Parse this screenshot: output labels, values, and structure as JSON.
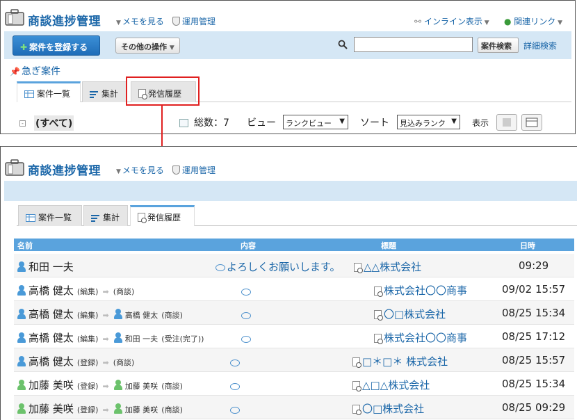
{
  "top": {
    "app_title": "商談進捗管理",
    "memo_link": "メモを見る",
    "admin_link": "運用管理",
    "inline_view": "インライン表示",
    "related_links": "関連リンク",
    "register_button": "案件を登録する",
    "other_ops_button": "その他の操作",
    "search_button": "案件検索",
    "advanced_search": "詳細検索",
    "search_value": "",
    "urgent": "急ぎ案件",
    "tabs": [
      {
        "label": "案件一覧",
        "active": true
      },
      {
        "label": "集計",
        "active": false
      },
      {
        "label": "発信履歴",
        "active": false
      }
    ],
    "filter_all": "(すべて)",
    "total": "総数：7",
    "view_label": "ビュー",
    "view_select": "ランクビュー",
    "sort_label": "ソート",
    "sort_select": "見込みランク",
    "display_label": "表示"
  },
  "bottom": {
    "app_title": "商談進捗管理",
    "memo_link": "メモを見る",
    "admin_link": "運用管理",
    "tabs": [
      {
        "label": "案件一覧",
        "active": false
      },
      {
        "label": "集計",
        "active": false
      },
      {
        "label": "発信履歴",
        "active": true
      }
    ],
    "columns": [
      "名前",
      "内容",
      "標題",
      "日時"
    ],
    "rows": [
      {
        "name": "和田 一夫",
        "action": "",
        "target": "",
        "target_action": "",
        "content": "よろしくお願いします。",
        "title": "△△株式会社",
        "time": "09:29",
        "color": "blue"
      },
      {
        "name": "高橋 健太",
        "action": "(編集)",
        "target": "",
        "target_action": "(商談)",
        "content": "",
        "title": "株式会社〇〇商事",
        "time": "09/02 15:57",
        "color": "blue"
      },
      {
        "name": "高橋 健太",
        "action": "(編集)",
        "target": "高橋 健太",
        "target_action": "(商談)",
        "content": "",
        "title": "〇□株式会社",
        "time": "08/25 15:34",
        "color": "blue"
      },
      {
        "name": "高橋 健太",
        "action": "(編集)",
        "target": "和田 一夫",
        "target_action": "(受注(完了))",
        "content": "",
        "title": "株式会社〇〇商事",
        "time": "08/25 17:12",
        "color": "blue"
      },
      {
        "name": "高橋 健太",
        "action": "(登録)",
        "target": "",
        "target_action": "(商談)",
        "content": "",
        "title": "□＊□＊ 株式会社",
        "time": "08/25 15:57",
        "color": "blue"
      },
      {
        "name": "加藤 美咲",
        "action": "(登録)",
        "target": "加藤 美咲",
        "target_action": "(商談)",
        "content": "",
        "title": "△□△株式会社",
        "time": "08/25 15:34",
        "color": "green"
      },
      {
        "name": "加藤 美咲",
        "action": "(登録)",
        "target": "加藤 美咲",
        "target_action": "(商談)",
        "content": "",
        "title": "〇□株式会社",
        "time": "08/25 09:29",
        "color": "green"
      }
    ]
  },
  "colors": {
    "accent": "#1a66a8",
    "band": "#d5e7f5",
    "table_header": "#5aa3dd",
    "highlight": "#e02020"
  }
}
